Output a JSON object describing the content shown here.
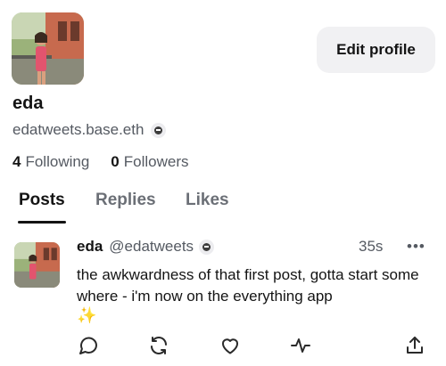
{
  "profile": {
    "avatar_icon": "profile-photo-avatar",
    "display_name": "eda",
    "handle": "edatweets.base.eth",
    "badge_icon": "base-network-icon",
    "edit_button_label": "Edit profile",
    "following_count": "4",
    "following_label": "Following",
    "followers_count": "0",
    "followers_label": "Followers"
  },
  "tabs": [
    {
      "label": "Posts",
      "active": true
    },
    {
      "label": "Replies",
      "active": false
    },
    {
      "label": "Likes",
      "active": false
    }
  ],
  "post": {
    "author_name": "eda",
    "author_handle": "@edatweets",
    "time": "35s",
    "more_icon": "•••",
    "text": "the awkwardness of that first post, gotta start some where - i'm now on the everything app",
    "emoji": "✨",
    "actions": [
      "reply-icon",
      "recast-icon",
      "like-icon",
      "activity-icon",
      "share-icon"
    ]
  },
  "colors": {
    "text_primary": "#141414",
    "text_secondary": "#555a62",
    "button_bg": "#f1f1f3",
    "sparkle": "#f0c64c"
  }
}
